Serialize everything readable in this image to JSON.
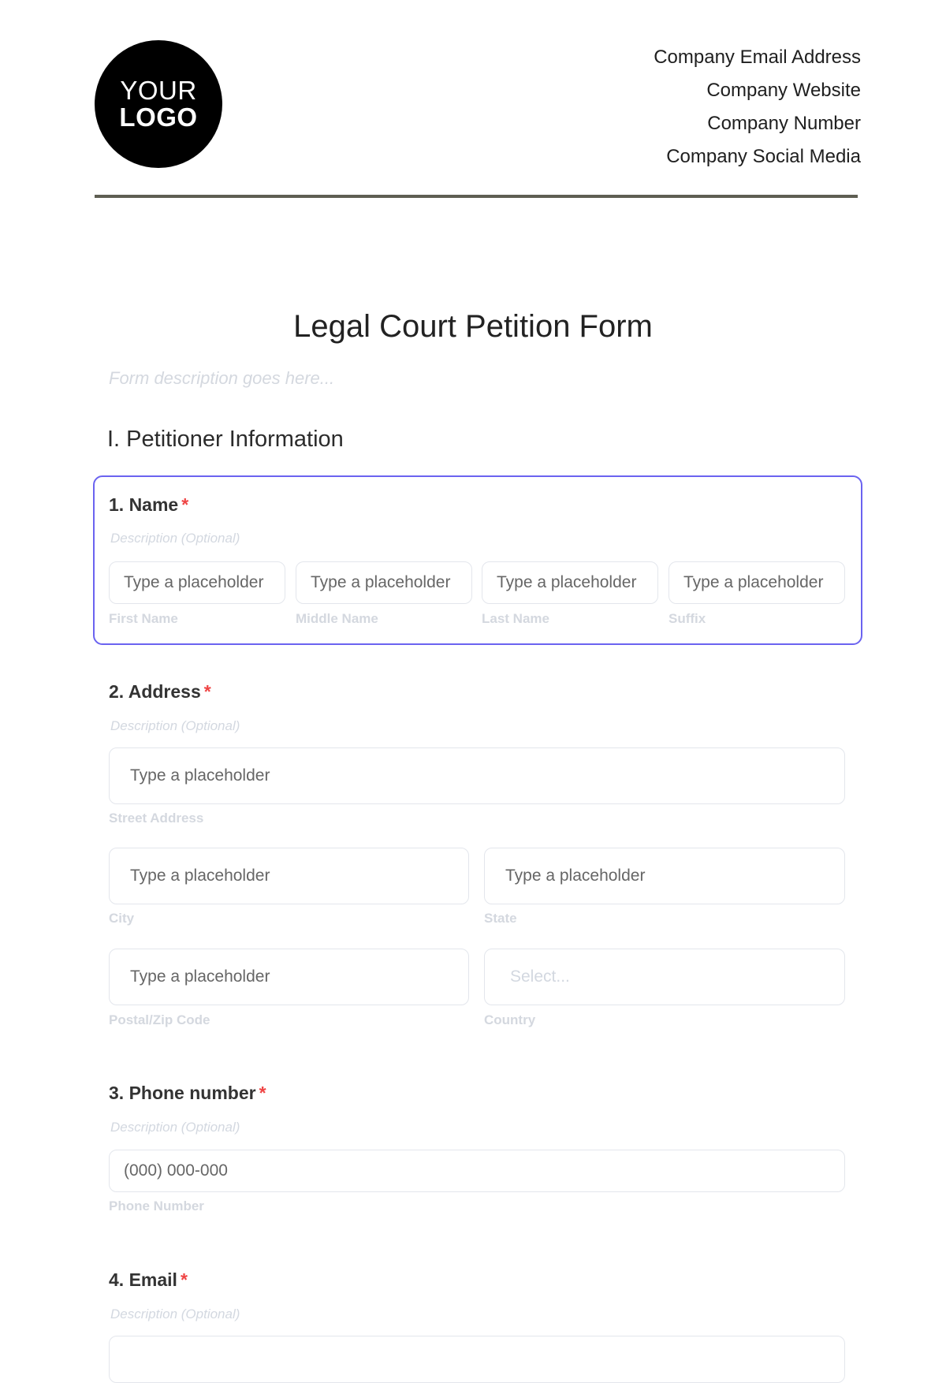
{
  "header": {
    "logo": {
      "line1": "YOUR",
      "line2": "LOGO"
    },
    "company_info": [
      "Company Email Address",
      "Company Website",
      "Company Number",
      "Company Social Media"
    ]
  },
  "form": {
    "title": "Legal Court Petition Form",
    "description_placeholder": "Form description goes here...",
    "section_title": "I. Petitioner Information",
    "required_marker": "*",
    "questions": {
      "name": {
        "label": "1. Name",
        "description": "Description (Optional)",
        "fields": [
          {
            "placeholder": "Type a placeholder",
            "sublabel": "First Name"
          },
          {
            "placeholder": "Type a placeholder",
            "sublabel": "Middle Name"
          },
          {
            "placeholder": "Type a placeholder",
            "sublabel": "Last Name"
          },
          {
            "placeholder": "Type a placeholder",
            "sublabel": "Suffix"
          }
        ]
      },
      "address": {
        "label": "2. Address",
        "description": "Description (Optional)",
        "street": {
          "placeholder": "Type a placeholder",
          "sublabel": "Street Address"
        },
        "city": {
          "placeholder": "Type a placeholder",
          "sublabel": "City"
        },
        "state": {
          "placeholder": "Type a placeholder",
          "sublabel": "State"
        },
        "zip": {
          "placeholder": "Type a placeholder",
          "sublabel": "Postal/Zip Code"
        },
        "country": {
          "placeholder": "Select...",
          "sublabel": "Country"
        }
      },
      "phone": {
        "label": "3. Phone number",
        "description": "Description (Optional)",
        "placeholder": "(000) 000-000",
        "sublabel": "Phone Number"
      },
      "email": {
        "label": "4. Email",
        "description": "Description (Optional)"
      }
    }
  },
  "colors": {
    "accent_border": "#6b63f0",
    "required": "#ef4444",
    "header_rule": "#5e5e52"
  }
}
